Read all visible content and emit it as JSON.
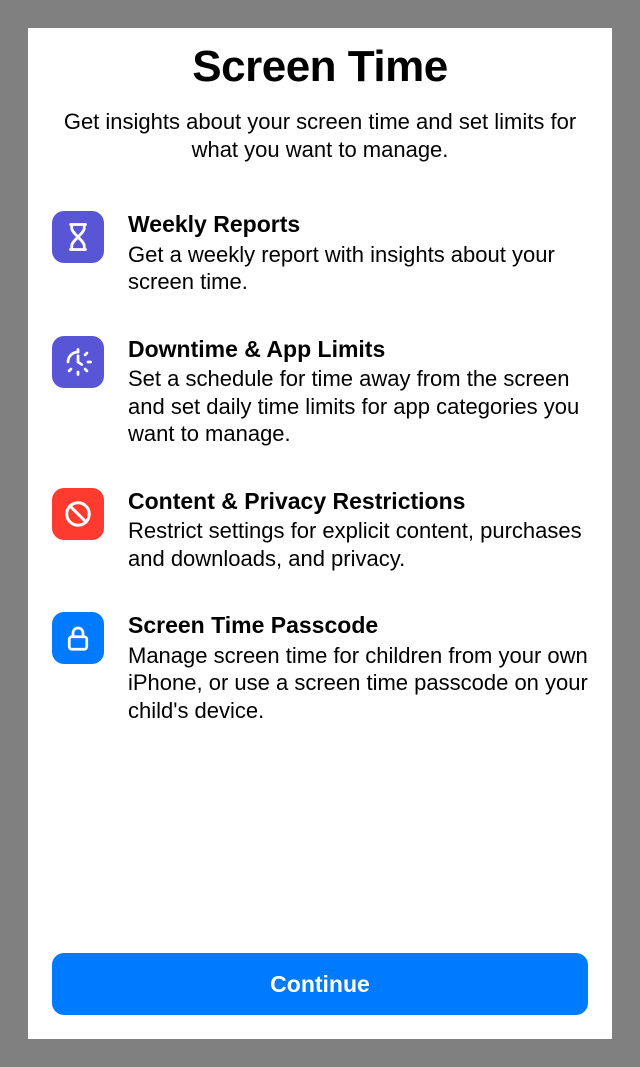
{
  "title": "Screen Time",
  "subtitle": "Get insights about your screen time and set limits for what you want to manage.",
  "features": [
    {
      "title": "Weekly Reports",
      "desc": "Get a weekly report with insights about your screen time."
    },
    {
      "title": "Downtime & App Limits",
      "desc": "Set a schedule for time away from the screen and set daily time limits for app categories you want to manage."
    },
    {
      "title": "Content & Privacy Restrictions",
      "desc": "Restrict settings for explicit content, purchases and downloads, and privacy."
    },
    {
      "title": "Screen Time Passcode",
      "desc": "Manage screen time for children from your own iPhone, or use a screen time passcode on your child's device."
    }
  ],
  "continue_label": "Continue"
}
